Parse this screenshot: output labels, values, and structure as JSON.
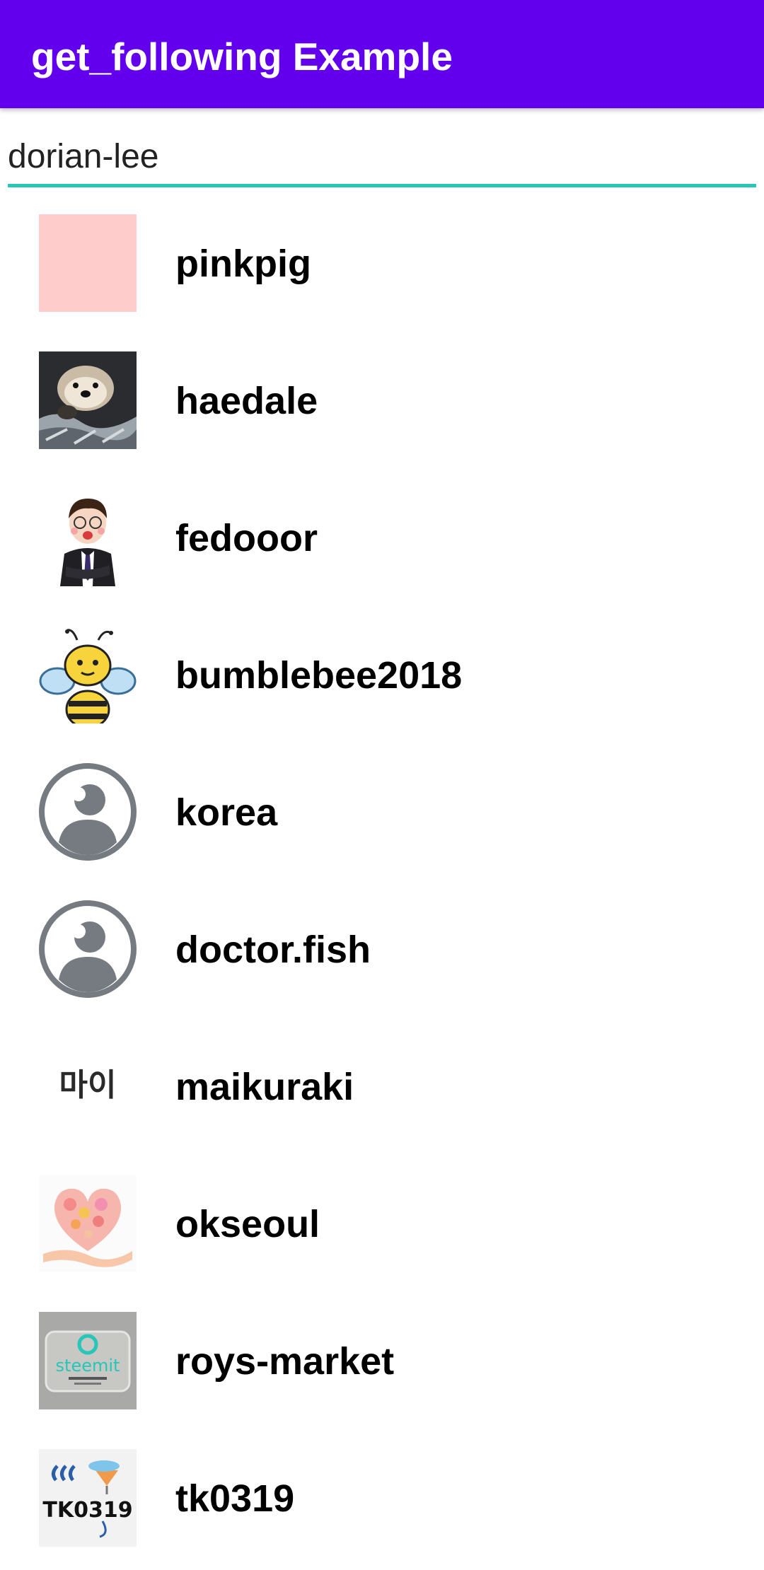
{
  "appbar": {
    "title": "get_following Example"
  },
  "search": {
    "value": "dorian-lee"
  },
  "colors": {
    "appbar": "#6200ee",
    "underline": "#26c6b8",
    "placeholder_avatar": "#ffcccc",
    "default_avatar": "#757b80"
  },
  "following": [
    {
      "name": "pinkpig",
      "avatar": "pink-square-icon"
    },
    {
      "name": "haedale",
      "avatar": "otter-photo-icon"
    },
    {
      "name": "fedooor",
      "avatar": "businessman-cartoon-icon"
    },
    {
      "name": "bumblebee2018",
      "avatar": "bee-cartoon-icon"
    },
    {
      "name": "korea",
      "avatar": "default-user-icon"
    },
    {
      "name": "doctor.fish",
      "avatar": "default-user-icon"
    },
    {
      "name": "maikuraki",
      "avatar": "hangul-text-icon",
      "avatar_text": "마이"
    },
    {
      "name": "okseoul",
      "avatar": "heart-hand-icon"
    },
    {
      "name": "roys-market",
      "avatar": "steemit-donation-icon",
      "avatar_text": "steemit"
    },
    {
      "name": "tk0319",
      "avatar": "tk0319-logo-icon",
      "avatar_text": "TK0319"
    }
  ]
}
